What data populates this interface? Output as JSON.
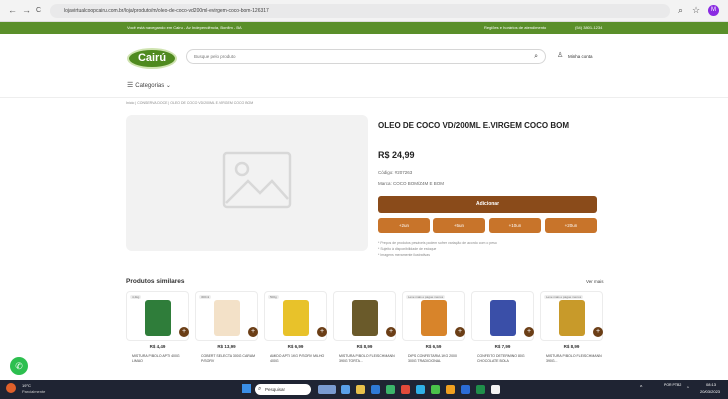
{
  "browser": {
    "back": "←",
    "forward": "→",
    "reload": "C",
    "url": "lojavirtualcoopcairu.com.br/loja/produto/m/oleo-de-coco-vd200ml-evirgem-coco-bom-126317",
    "zoom_icon": "search-icon",
    "star": "☆",
    "profile": "M"
  },
  "topbar": {
    "text": "Você está navegando em Cairu - Av Independência, Bonfim - BA",
    "hours": "Regiões e horários de atendimento",
    "phone": "(54) 3801-1234"
  },
  "header": {
    "logo": "Cairú",
    "search_placeholder": "Busque pelo produto",
    "login": "Minha conta",
    "categories": "Categorias"
  },
  "breadcrumb": "Início | CONSERVA DOCE | OLEO DE COCO VD/200ML E.VIRGEM COCO BOM",
  "product": {
    "title": "OLEO DE COCO VD/200ML E.VIRGEM COCO BOM",
    "price": "R$ 24,99",
    "code": "Código: #207263",
    "brand": "Marca: COCO BOM/Z4M E BOM",
    "add": "Adicionar",
    "qty": [
      "+2un",
      "+5un",
      "+10un",
      "+20un"
    ],
    "notes": [
      "* Preços de produtos pesáveis podem sofrer variação de acordo com o peso",
      "* Sujeito à disponibilidade de estoque",
      "* Imagens meramente ilustrativas"
    ]
  },
  "similar": {
    "title": "Produtos similares",
    "more": "Ver mais",
    "items": [
      {
        "badge": "4,4kg",
        "price": "R$ 4,49",
        "name": "MISTURA P/BOLO APTI 400G LIMAO",
        "color": "#2f7d3a"
      },
      {
        "badge": "300ml",
        "price": "R$ 13,99",
        "name": "COBERT SELECTA 300G CARAM P/SORV",
        "color": "#f3e1c8"
      },
      {
        "badge": "500g",
        "price": "R$ 6,99",
        "name": "AMIDO APTI 1KG P/SORV MILHO 400G",
        "color": "#e8c22a"
      },
      {
        "badge": "",
        "price": "R$ 8,99",
        "name": "MISTURA P/BOLO FLEISCHMANN 390G TORTA...",
        "color": "#6a5a2a"
      },
      {
        "badge": "Leve mais e pague menos",
        "price": "R$ 6,59",
        "name": "DIPS CONFEITARIA 1KG 2000 300G TRADICIONAL",
        "color": "#d8842a"
      },
      {
        "badge": "",
        "price": "R$ 7,99",
        "name": "CONFEITO DETERMINO 80G CHOCOLATE BOLA",
        "color": "#3a4fa8"
      },
      {
        "badge": "Leve mais e pague menos",
        "price": "R$ 8,99",
        "name": "MISTURA P/BOLO FLEISCHMANN 390G...",
        "color": "#c89a2a"
      }
    ]
  },
  "taskbar": {
    "weather_temp": "19°C",
    "weather_text": "Parcialmente",
    "search": "Pesquisar",
    "lang": "POR PTB2",
    "time": "08:13",
    "date": "20/03/2023"
  }
}
